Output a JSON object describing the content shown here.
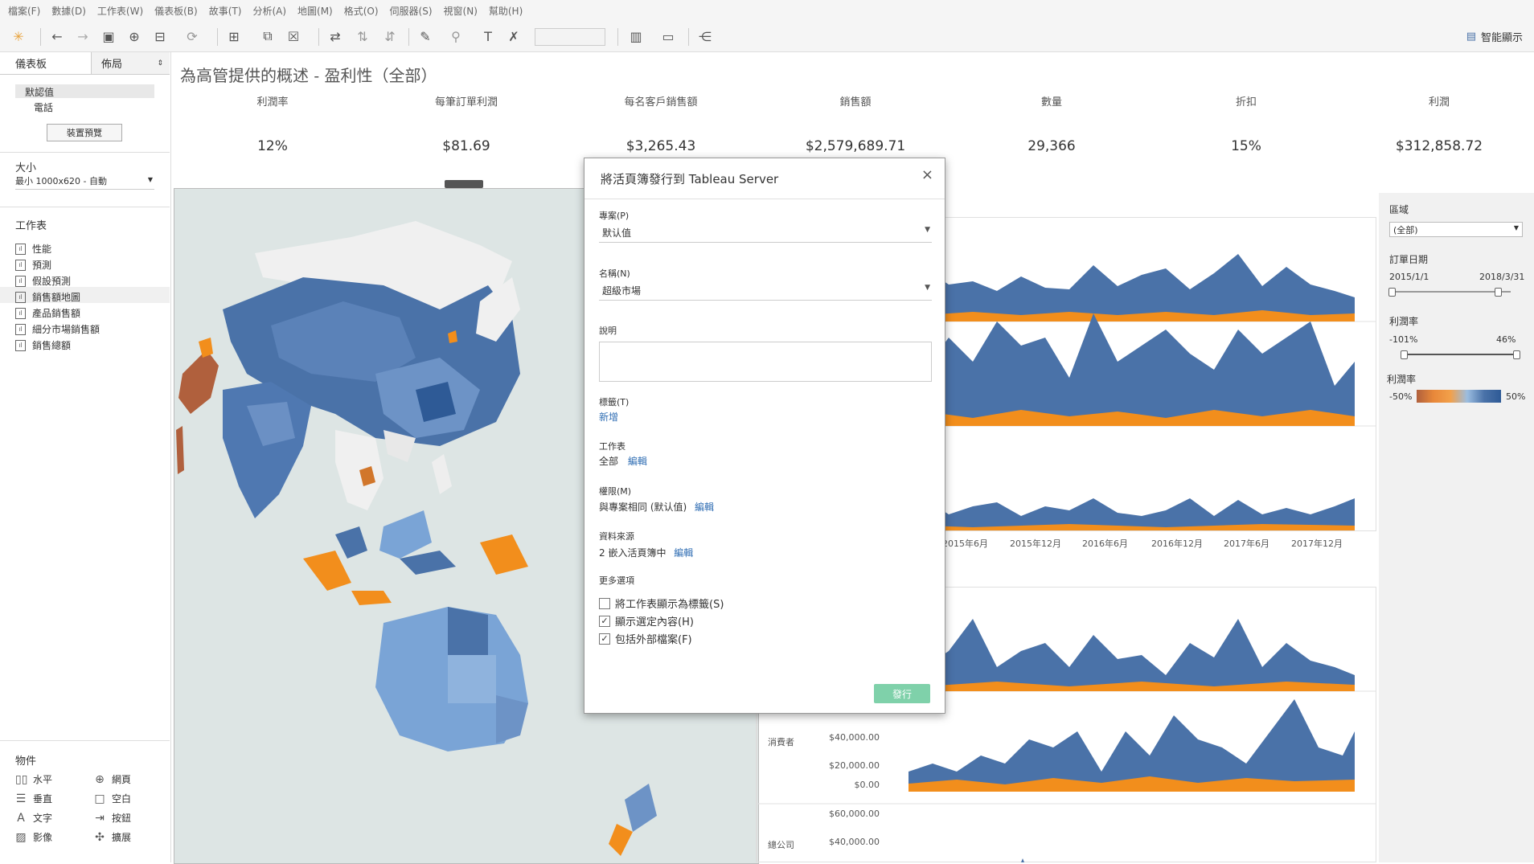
{
  "menu": [
    "檔案(F)",
    "數據(D)",
    "工作表(W)",
    "儀表板(B)",
    "故事(T)",
    "分析(A)",
    "地圖(M)",
    "格式(O)",
    "伺服器(S)",
    "視窗(N)",
    "幫助(H)"
  ],
  "toolbar": {
    "smart_show": "智能顯示"
  },
  "left_panel": {
    "tab_dashboard": "儀表板",
    "tab_layout": "佈局",
    "devices": [
      "默認值",
      "電話"
    ],
    "device_preview_button": "裝置預覽",
    "size_title": "大小",
    "size_value": "最小 1000x620 - 自動",
    "sheets_title": "工作表",
    "sheets": [
      "性能",
      "預測",
      "假設預測",
      "銷售額地圖",
      "產品銷售額",
      "細分市場銷售額",
      "銷售總額"
    ],
    "objects_title": "物件",
    "objects": [
      "水平",
      "網頁",
      "垂直",
      "空白",
      "文字",
      "按鈕",
      "影像",
      "擴展"
    ]
  },
  "dashboard": {
    "title": "為高管提供的概述 - 盈利性（全部）",
    "kpis": [
      {
        "label": "利潤率",
        "value": "12%"
      },
      {
        "label": "每筆訂單利潤",
        "value": "$81.69"
      },
      {
        "label": "每名客戶銷售額",
        "value": "$3,265.43"
      },
      {
        "label": "銷售額",
        "value": "$2,579,689.71"
      },
      {
        "label": "數量",
        "value": "29,366"
      },
      {
        "label": "折扣",
        "value": "15%"
      },
      {
        "label": "利潤",
        "value": "$312,858.72"
      }
    ],
    "timeline_ticks": [
      "2015年6月",
      "2015年12月",
      "2016年6月",
      "2016年12月",
      "2017年6月",
      "2017年12月"
    ],
    "segments": [
      "消費者",
      "總公司"
    ],
    "y_ticks_consumer": [
      "$40,000.00",
      "$20,000.00",
      "$0.00"
    ],
    "y_ticks_corporate": [
      "$60,000.00",
      "$40,000.00"
    ],
    "colors": {
      "blue": "#4a72a8",
      "orange": "#f28e1c"
    }
  },
  "filters": {
    "region_title": "區域",
    "region_value": "(全部)",
    "order_date_title": "訂單日期",
    "date_start": "2015/1/1",
    "date_end": "2018/3/31",
    "margin_title": "利潤率",
    "margin_min": "-101%",
    "margin_max": "46%",
    "legend_title": "利潤率",
    "legend_min": "-50%",
    "legend_max": "50%"
  },
  "dialog": {
    "title": "將活頁簿發行到 Tableau Server",
    "project_label": "專案(P)",
    "project_value": "默认值",
    "name_label": "名稱(N)",
    "name_value": "超級市場",
    "description_label": "說明",
    "tags_label": "標籤(T)",
    "tags_link": "新增",
    "sheets_label": "工作表",
    "sheets_value": "全部",
    "edit": "編輯",
    "permissions_label": "權限(M)",
    "permissions_value": "與專案相同 (默认值)",
    "datasource_label": "資料來源",
    "datasource_value": "2 嵌入活頁簿中",
    "more_options": "更多選項",
    "opt_tabs": "將工作表顯示為標籤(S)",
    "opt_selection": "顯示選定內容(H)",
    "opt_external": "包括外部檔案(F)",
    "publish_button": "發行"
  }
}
